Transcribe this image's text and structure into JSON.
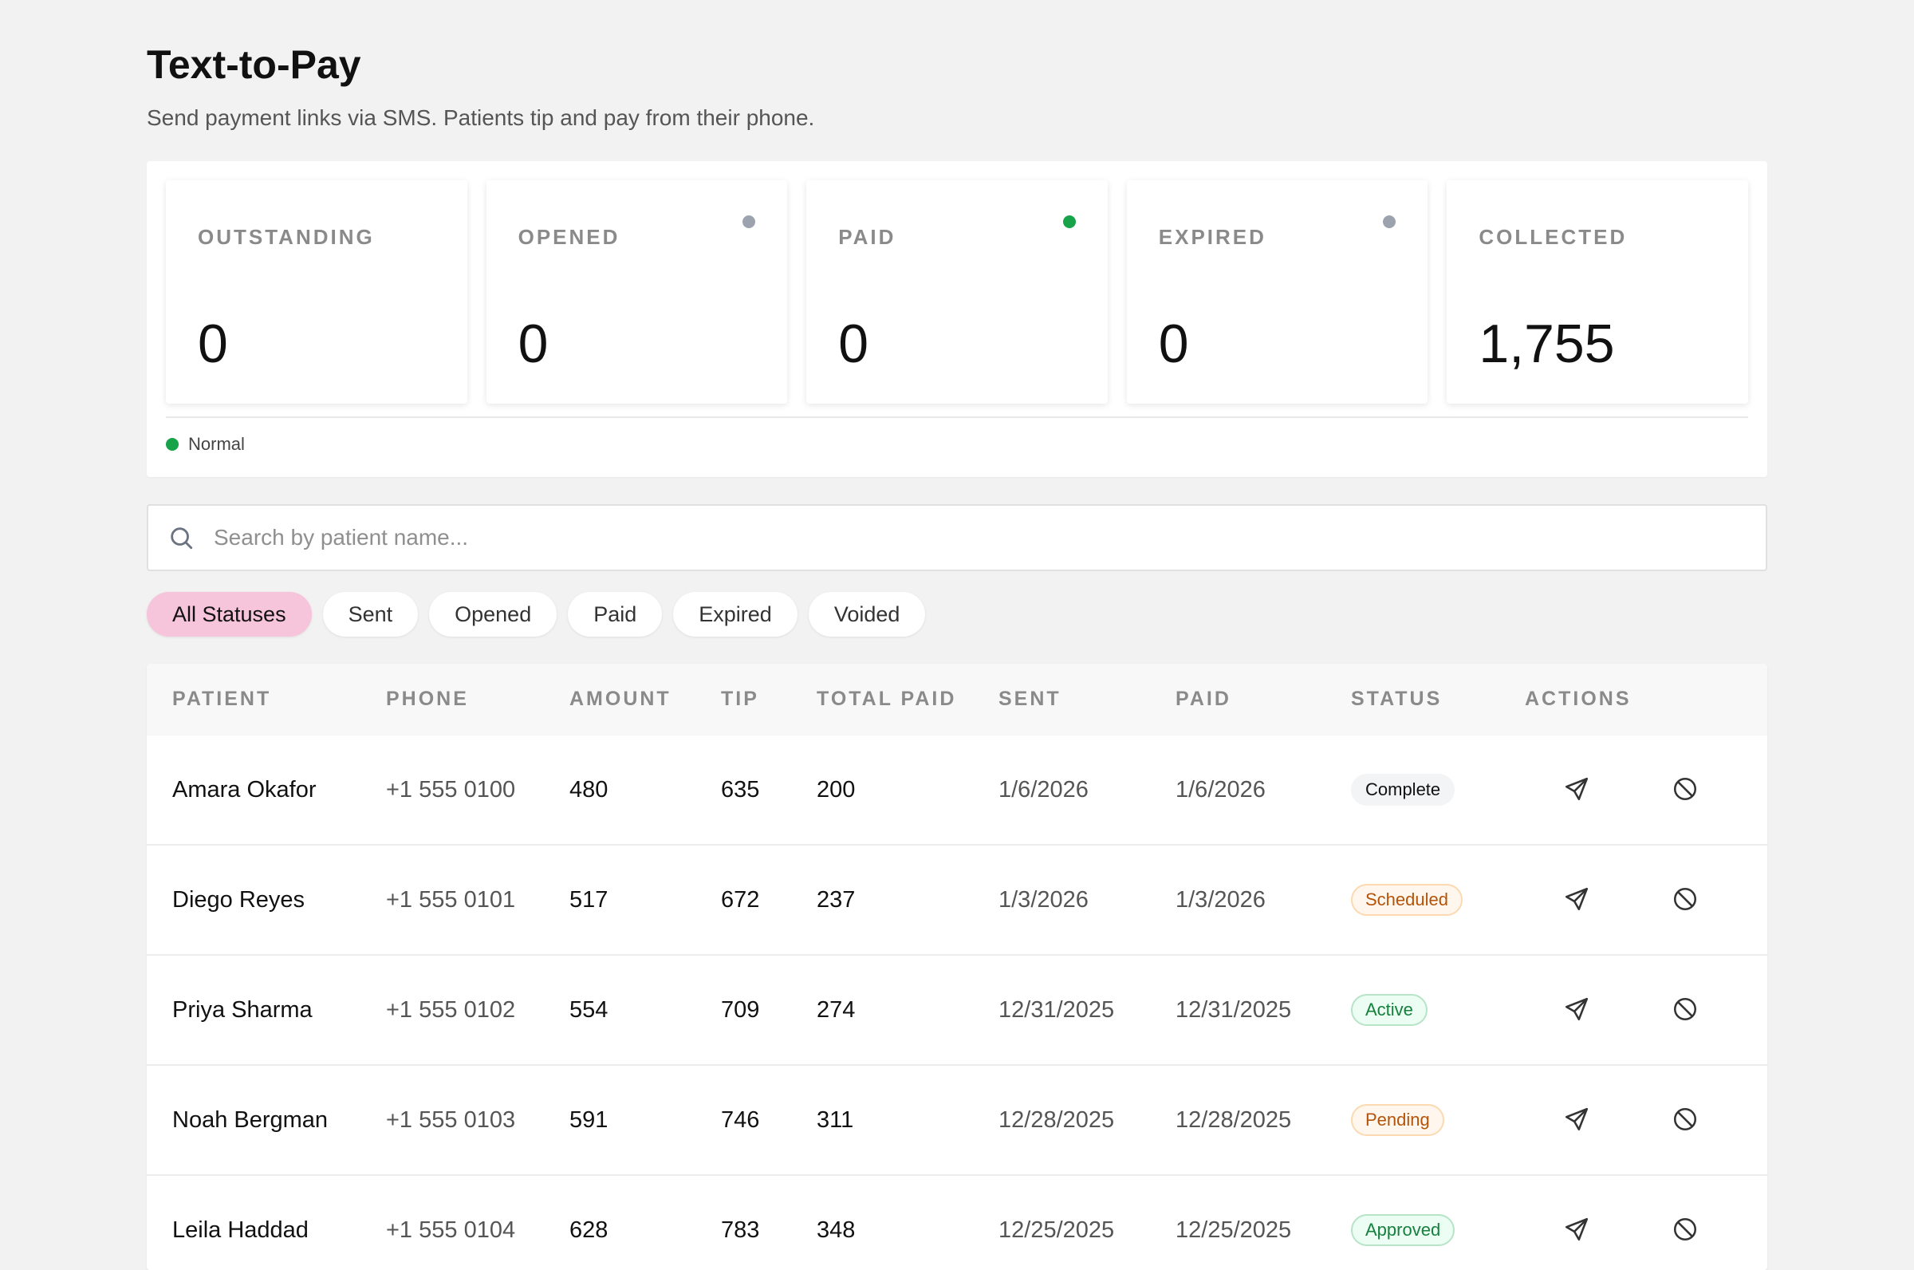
{
  "header": {
    "title": "Text-to-Pay",
    "subtitle": "Send payment links via SMS. Patients tip and pay from their phone."
  },
  "stats": [
    {
      "label": "OUTSTANDING",
      "value": "0",
      "dot": null
    },
    {
      "label": "OPENED",
      "value": "0",
      "dot": "#9ca3af"
    },
    {
      "label": "PAID",
      "value": "0",
      "dot": "#16a34a"
    },
    {
      "label": "EXPIRED",
      "value": "0",
      "dot": "#9ca3af"
    },
    {
      "label": "COLLECTED",
      "value": "1,755",
      "dot": null
    }
  ],
  "legend": {
    "label": "Normal",
    "color": "#16a34a"
  },
  "search": {
    "placeholder": "Search by patient name...",
    "value": ""
  },
  "filters": [
    {
      "label": "All Statuses",
      "active": true
    },
    {
      "label": "Sent",
      "active": false
    },
    {
      "label": "Opened",
      "active": false
    },
    {
      "label": "Paid",
      "active": false
    },
    {
      "label": "Expired",
      "active": false
    },
    {
      "label": "Voided",
      "active": false
    }
  ],
  "table": {
    "columns": [
      "PATIENT",
      "PHONE",
      "AMOUNT",
      "TIP",
      "TOTAL PAID",
      "SENT",
      "PAID",
      "STATUS",
      "ACTIONS"
    ],
    "rows": [
      {
        "patient": "Amara Okafor",
        "phone": "+1 555 0100",
        "amount": "480",
        "tip": "635",
        "total": "200",
        "sent": "1/6/2026",
        "paid": "1/6/2026",
        "status": "Complete"
      },
      {
        "patient": "Diego Reyes",
        "phone": "+1 555 0101",
        "amount": "517",
        "tip": "672",
        "total": "237",
        "sent": "1/3/2026",
        "paid": "1/3/2026",
        "status": "Scheduled"
      },
      {
        "patient": "Priya Sharma",
        "phone": "+1 555 0102",
        "amount": "554",
        "tip": "709",
        "total": "274",
        "sent": "12/31/2025",
        "paid": "12/31/2025",
        "status": "Active"
      },
      {
        "patient": "Noah Bergman",
        "phone": "+1 555 0103",
        "amount": "591",
        "tip": "746",
        "total": "311",
        "sent": "12/28/2025",
        "paid": "12/28/2025",
        "status": "Pending"
      },
      {
        "patient": "Leila Haddad",
        "phone": "+1 555 0104",
        "amount": "628",
        "tip": "783",
        "total": "348",
        "sent": "12/25/2025",
        "paid": "12/25/2025",
        "status": "Approved"
      }
    ],
    "actions": {
      "send_icon": "send-icon",
      "void_icon": "void-icon"
    }
  },
  "badge_colors": {
    "Complete": {
      "bg": "#f3f4f6",
      "fg": "#111111",
      "border": "#f3f4f6"
    },
    "Scheduled": {
      "bg": "#fff7ed",
      "fg": "#b45309",
      "border": "#fcd9b0"
    },
    "Active": {
      "bg": "#ecfdf3",
      "fg": "#15803d",
      "border": "#b7e4c7"
    },
    "Pending": {
      "bg": "#fff7ed",
      "fg": "#b45309",
      "border": "#fcd9b0"
    },
    "Approved": {
      "bg": "#ecfdf3",
      "fg": "#15803d",
      "border": "#b7e4c7"
    }
  }
}
